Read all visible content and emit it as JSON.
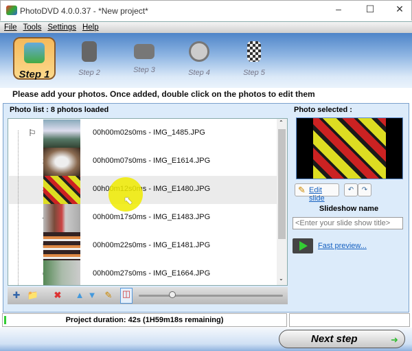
{
  "window": {
    "title": "PhotoDVD 4.0.0.37 - *New project*"
  },
  "menu": [
    "File",
    "Tools",
    "Settings",
    "Help"
  ],
  "steps": [
    "Step 1",
    "Step 2",
    "Step 3",
    "Step 4",
    "Step 5"
  ],
  "instruction": "Please add your photos. Once added, double click on the photos to edit them",
  "photo_list": {
    "label": "Photo list : 8 photos loaded",
    "rows": [
      {
        "num": "1",
        "text": "00h00m02s0ms - IMG_1485.JPG"
      },
      {
        "num": "2",
        "text": "00h00m07s0ms - IMG_E1614.JPG"
      },
      {
        "num": "3",
        "text": "00h00m12s0ms - IMG_E1480.JPG"
      },
      {
        "num": "4",
        "text": "00h00m17s0ms - IMG_E1483.JPG"
      },
      {
        "num": "5",
        "text": "00h00m22s0ms - IMG_E1481.JPG"
      },
      {
        "num": "6",
        "text": "00h00m27s0ms - IMG_E1664.JPG"
      }
    ]
  },
  "right": {
    "photo_selected": "Photo selected :",
    "edit_slide": "Edit slide",
    "slideshow_name": "Slideshow name",
    "slideshow_placeholder": "<Enter your slide show title>",
    "fast_preview": "Fast preview..."
  },
  "status": {
    "duration": "Project duration: 42s (1H59m18s remaining)"
  },
  "next_step": "Next step",
  "colors": {
    "accent": "#f6b95a",
    "link": "#1560c0"
  }
}
